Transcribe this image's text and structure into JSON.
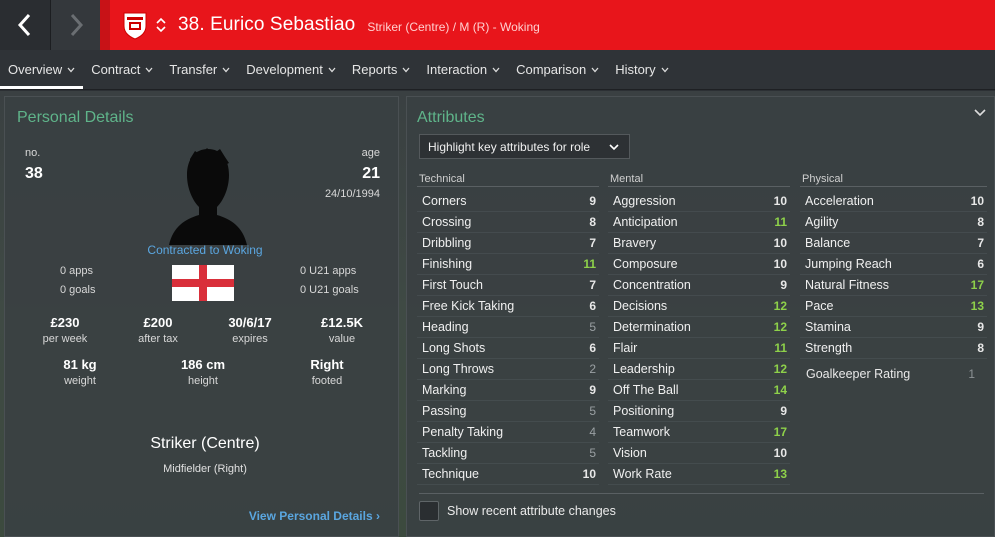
{
  "header": {
    "title": "38. Eurico Sebastiao",
    "subtitle": "Striker (Centre) / M (R) - Woking",
    "accent": "#e8151b"
  },
  "tabs": [
    {
      "label": "Overview",
      "active": true
    },
    {
      "label": "Contract"
    },
    {
      "label": "Transfer"
    },
    {
      "label": "Development"
    },
    {
      "label": "Reports"
    },
    {
      "label": "Interaction"
    },
    {
      "label": "Comparison"
    },
    {
      "label": "History"
    }
  ],
  "personal": {
    "title": "Personal Details",
    "no_label": "no.",
    "no_value": "38",
    "age_label": "age",
    "age_value": "21",
    "dob": "24/10/1994",
    "contracted": "Contracted to Woking",
    "apps": "0 apps",
    "goals": "0 goals",
    "u21_apps": "0 U21 apps",
    "u21_goals": "0 U21 goals",
    "wage": {
      "value": "£230",
      "label": "per week"
    },
    "after_tax": {
      "value": "£200",
      "label": "after tax"
    },
    "expires": {
      "value": "30/6/17",
      "label": "expires"
    },
    "market_value": {
      "value": "£12.5K",
      "label": "value"
    },
    "weight": {
      "value": "81 kg",
      "label": "weight"
    },
    "height": {
      "value": "186 cm",
      "label": "height"
    },
    "foot": {
      "value": "Right",
      "label": "footed"
    },
    "position_main": "Striker (Centre)",
    "position_sub": "Midfielder (Right)",
    "view_link": "View Personal Details"
  },
  "attributes": {
    "title": "Attributes",
    "highlight_label": "Highlight key attributes for role",
    "show_changes": "Show recent attribute changes",
    "technical": {
      "heading": "Technical",
      "rows": [
        {
          "name": "Corners",
          "value": "9"
        },
        {
          "name": "Crossing",
          "value": "8"
        },
        {
          "name": "Dribbling",
          "value": "7"
        },
        {
          "name": "Finishing",
          "value": "11",
          "tone": "green"
        },
        {
          "name": "First Touch",
          "value": "7"
        },
        {
          "name": "Free Kick Taking",
          "value": "6"
        },
        {
          "name": "Heading",
          "value": "5",
          "tone": "dim"
        },
        {
          "name": "Long Shots",
          "value": "6"
        },
        {
          "name": "Long Throws",
          "value": "2",
          "tone": "dim"
        },
        {
          "name": "Marking",
          "value": "9"
        },
        {
          "name": "Passing",
          "value": "5",
          "tone": "dim"
        },
        {
          "name": "Penalty Taking",
          "value": "4",
          "tone": "dim"
        },
        {
          "name": "Tackling",
          "value": "5",
          "tone": "dim"
        },
        {
          "name": "Technique",
          "value": "10"
        }
      ]
    },
    "mental": {
      "heading": "Mental",
      "rows": [
        {
          "name": "Aggression",
          "value": "10"
        },
        {
          "name": "Anticipation",
          "value": "11",
          "tone": "green"
        },
        {
          "name": "Bravery",
          "value": "10"
        },
        {
          "name": "Composure",
          "value": "10"
        },
        {
          "name": "Concentration",
          "value": "9"
        },
        {
          "name": "Decisions",
          "value": "12",
          "tone": "green"
        },
        {
          "name": "Determination",
          "value": "12",
          "tone": "green"
        },
        {
          "name": "Flair",
          "value": "11",
          "tone": "green"
        },
        {
          "name": "Leadership",
          "value": "12",
          "tone": "green"
        },
        {
          "name": "Off The Ball",
          "value": "14",
          "tone": "green"
        },
        {
          "name": "Positioning",
          "value": "9"
        },
        {
          "name": "Teamwork",
          "value": "17",
          "tone": "green"
        },
        {
          "name": "Vision",
          "value": "10"
        },
        {
          "name": "Work Rate",
          "value": "13",
          "tone": "green"
        }
      ]
    },
    "physical": {
      "heading": "Physical",
      "rows": [
        {
          "name": "Acceleration",
          "value": "10"
        },
        {
          "name": "Agility",
          "value": "8"
        },
        {
          "name": "Balance",
          "value": "7"
        },
        {
          "name": "Jumping Reach",
          "value": "6"
        },
        {
          "name": "Natural Fitness",
          "value": "17",
          "tone": "green"
        },
        {
          "name": "Pace",
          "value": "13",
          "tone": "green"
        },
        {
          "name": "Stamina",
          "value": "9"
        },
        {
          "name": "Strength",
          "value": "8"
        }
      ],
      "gk_label": "Goalkeeper Rating",
      "gk_value": "1"
    }
  }
}
